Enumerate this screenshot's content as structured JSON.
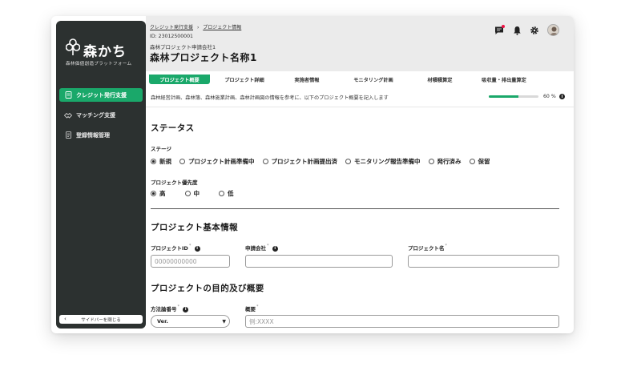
{
  "sidebar": {
    "logo_text": "森かち",
    "logo_sub": "森林価値創造プラットフォーム",
    "items": [
      {
        "label": "クレジット発行支援",
        "icon": "credit-icon",
        "active": true
      },
      {
        "label": "マッチング支援",
        "icon": "handshake-icon",
        "active": false
      },
      {
        "label": "登録情報管理",
        "icon": "document-icon",
        "active": false
      }
    ],
    "collapse_label": "サイドバーを閉じる"
  },
  "header": {
    "breadcrumb": [
      "クレジット発行支援",
      "プロジェクト情報"
    ],
    "breadcrumb_sep": "›",
    "project_id": "ID: 23012500001",
    "company": "森林プロジェクト申請会社1",
    "project_name": "森林プロジェクト名称1",
    "icons": [
      "chat-icon",
      "bell-icon",
      "gear-icon",
      "avatar"
    ]
  },
  "tabs": [
    {
      "label": "プロジェクト概要",
      "active": true
    },
    {
      "label": "プロジェクト詳細",
      "active": false
    },
    {
      "label": "実施者情報",
      "active": false
    },
    {
      "label": "モニタリング計画",
      "active": false
    },
    {
      "label": "材積積算定",
      "active": false
    },
    {
      "label": "吸収量・排出量算定",
      "active": false
    }
  ],
  "description": "森林経営計画、森林簿、森林施業計画、森林計画図の情報を参考に、以下のプロジェクト概要を記入します",
  "progress": {
    "value": 60,
    "label": "60 %"
  },
  "status_section": {
    "title": "ステータス",
    "stage_label": "ステージ",
    "stages": [
      {
        "label": "新規",
        "selected": true
      },
      {
        "label": "プロジェクト計画準備中",
        "selected": false
      },
      {
        "label": "プロジェクト計画提出済",
        "selected": false
      },
      {
        "label": "モニタリング報告準備中",
        "selected": false
      },
      {
        "label": "発行済み",
        "selected": false
      },
      {
        "label": "保留",
        "selected": false
      }
    ],
    "priority_label": "プロジェクト優先度",
    "priorities": [
      {
        "label": "高",
        "selected": true
      },
      {
        "label": "中",
        "selected": false
      },
      {
        "label": "低",
        "selected": false
      }
    ]
  },
  "basic_section": {
    "title": "プロジェクト基本情報",
    "project_id_label": "プロジェクトID",
    "project_id_placeholder": "00000000000",
    "company_label": "申請会社",
    "project_name_label": "プロジェクト名",
    "required_mark": "*"
  },
  "purpose_section": {
    "title": "プロジェクトの目的及び概要",
    "method_label": "方法論番号",
    "method_value": "Ver.",
    "summary_label": "概要",
    "summary_placeholder": "例:XXXX"
  }
}
